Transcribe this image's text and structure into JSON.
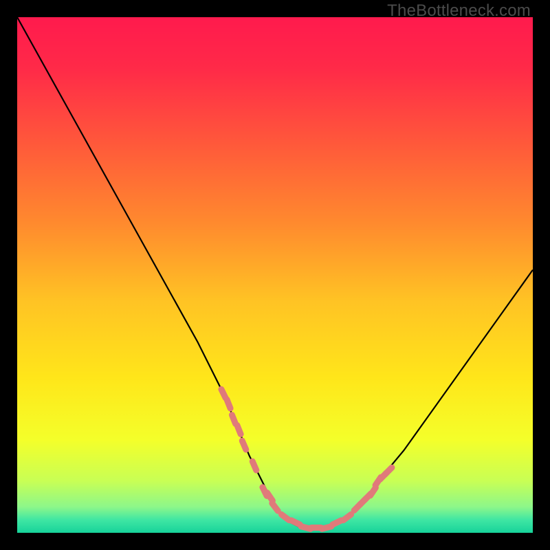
{
  "watermark": "TheBottleneck.com",
  "chart_data": {
    "type": "line",
    "title": "",
    "xlabel": "",
    "ylabel": "",
    "xlim": [
      0,
      100
    ],
    "ylim": [
      0,
      100
    ],
    "grid": false,
    "legend": false,
    "gradient_stops": [
      {
        "offset": 0.0,
        "color": "#ff1a4d"
      },
      {
        "offset": 0.1,
        "color": "#ff2a48"
      },
      {
        "offset": 0.25,
        "color": "#ff5a3a"
      },
      {
        "offset": 0.4,
        "color": "#ff8a2e"
      },
      {
        "offset": 0.55,
        "color": "#ffc324"
      },
      {
        "offset": 0.7,
        "color": "#ffe61a"
      },
      {
        "offset": 0.82,
        "color": "#f4ff2a"
      },
      {
        "offset": 0.9,
        "color": "#c8ff55"
      },
      {
        "offset": 0.95,
        "color": "#8cf78a"
      },
      {
        "offset": 0.975,
        "color": "#3fe6a3"
      },
      {
        "offset": 1.0,
        "color": "#17d39a"
      }
    ],
    "series": [
      {
        "name": "curve",
        "color": "#000000",
        "x": [
          0,
          5,
          10,
          15,
          20,
          25,
          30,
          35,
          40,
          45,
          47,
          50,
          53,
          55,
          57,
          60,
          62,
          65,
          68,
          70,
          75,
          80,
          85,
          90,
          95,
          100
        ],
        "values": [
          100,
          91,
          82,
          73,
          64,
          55,
          46,
          37,
          27,
          15,
          11,
          5,
          2,
          1,
          1,
          1,
          2,
          4,
          7,
          10,
          16,
          23,
          30,
          37,
          44,
          51
        ]
      },
      {
        "name": "marker-band",
        "type": "scatter",
        "color": "#e07a7a",
        "x": [
          40,
          41,
          42,
          43,
          44,
          46,
          48,
          49,
          50,
          52,
          54,
          56,
          58,
          60,
          62,
          64,
          66,
          67,
          68,
          69,
          70,
          71,
          72
        ],
        "values": [
          27,
          25,
          22,
          20,
          17,
          13,
          8,
          7,
          5,
          3,
          2,
          1,
          1,
          1,
          2,
          3,
          5,
          6,
          7,
          8,
          10,
          11,
          12
        ]
      }
    ],
    "annotations": []
  }
}
